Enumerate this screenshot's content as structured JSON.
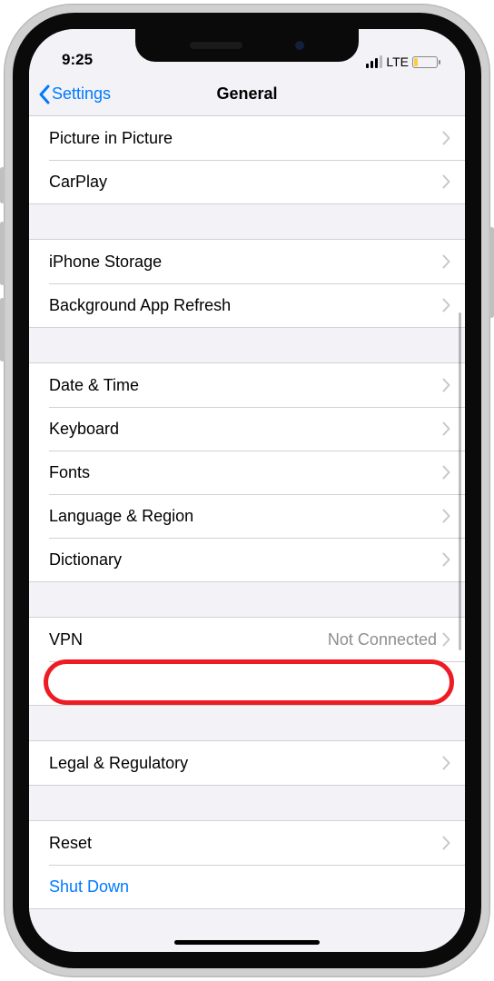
{
  "statusBar": {
    "time": "9:25",
    "network": "LTE"
  },
  "nav": {
    "back": "Settings",
    "title": "General"
  },
  "groups": [
    {
      "rows": [
        {
          "label": "Picture in Picture",
          "detail": "",
          "chevron": true,
          "link": false
        },
        {
          "label": "CarPlay",
          "detail": "",
          "chevron": true,
          "link": false
        }
      ]
    },
    {
      "rows": [
        {
          "label": "iPhone Storage",
          "detail": "",
          "chevron": true,
          "link": false
        },
        {
          "label": "Background App Refresh",
          "detail": "",
          "chevron": true,
          "link": false
        }
      ]
    },
    {
      "rows": [
        {
          "label": "Date & Time",
          "detail": "",
          "chevron": true,
          "link": false
        },
        {
          "label": "Keyboard",
          "detail": "",
          "chevron": true,
          "link": false
        },
        {
          "label": "Fonts",
          "detail": "",
          "chevron": true,
          "link": false
        },
        {
          "label": "Language & Region",
          "detail": "",
          "chevron": true,
          "link": false
        },
        {
          "label": "Dictionary",
          "detail": "",
          "chevron": true,
          "link": false
        }
      ]
    },
    {
      "rows": [
        {
          "label": "VPN",
          "detail": "Not Connected",
          "chevron": true,
          "link": false
        },
        {
          "label": "",
          "detail": "",
          "chevron": false,
          "link": false,
          "highlighted": true
        }
      ]
    },
    {
      "rows": [
        {
          "label": "Legal & Regulatory",
          "detail": "",
          "chevron": true,
          "link": false
        }
      ]
    },
    {
      "rows": [
        {
          "label": "Reset",
          "detail": "",
          "chevron": true,
          "link": false
        },
        {
          "label": "Shut Down",
          "detail": "",
          "chevron": false,
          "link": true
        }
      ]
    }
  ]
}
